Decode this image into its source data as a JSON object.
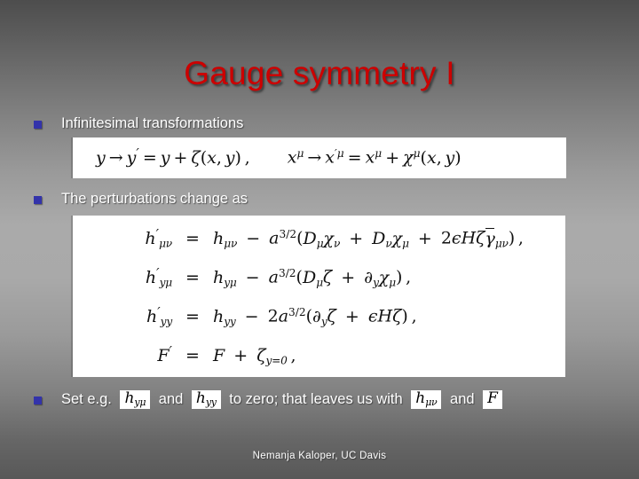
{
  "slide": {
    "title": "Gauge symmetry I",
    "title_color": "#cc0000",
    "background": {
      "top_color": "#4d4d4d",
      "mid_color": "#aaaaaa",
      "bottom_color": "#585858"
    },
    "bullet_color": "#3333aa",
    "text_color": "#ffffff"
  },
  "bullets": [
    {
      "label": "Infinitesimal transformations"
    },
    {
      "label": "The perturbations change as"
    }
  ],
  "final_bullet": {
    "text_1": "Set e.g.",
    "formula_1": {
      "base": "h",
      "sub": "yμ"
    },
    "text_2": "and",
    "formula_2": {
      "base": "h",
      "sub": "yy"
    },
    "text_3": "to zero; that leaves us with",
    "formula_3": {
      "base": "h",
      "sub": "μν"
    },
    "text_4": "and",
    "formula_4": {
      "base": "F",
      "sub": ""
    }
  },
  "equation_block_1": {
    "eq_1": {
      "lhs": "y",
      "arrow": "→",
      "mid": "y′",
      "equals": "=",
      "rhs": "y + ζ(x, y) ,"
    },
    "eq_2": {
      "lhs": "x^μ",
      "arrow": "→",
      "mid": "x′^μ",
      "equals": "=",
      "rhs": "x^μ + χ^μ(x, y)"
    }
  },
  "equation_block_2": {
    "rows": [
      {
        "lhs": "h′_μν",
        "equals": "=",
        "rhs": "h_μν − a^{3/2}(D_μ χ_ν + D_ν χ_μ + 2εHζ γ̄_μν) ,"
      },
      {
        "lhs": "h′_yμ",
        "equals": "=",
        "rhs": "h_yμ − a^{3/2}(D_μ ζ + ∂_y χ_μ) ,"
      },
      {
        "lhs": "h′_yy",
        "equals": "=",
        "rhs": "h_yy − 2a^{3/2}(∂_y ζ + εHζ) ,"
      },
      {
        "lhs": "F′",
        "equals": "=",
        "rhs": "F + ζ_{y=0} ,"
      }
    ]
  },
  "footer": {
    "text": "Nemanja Kaloper, UC Davis"
  }
}
